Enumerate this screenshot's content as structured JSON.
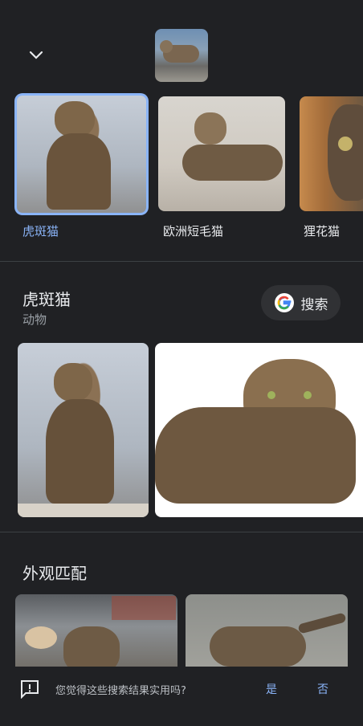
{
  "header": {
    "collapse_icon": "chevron-down-icon",
    "query_thumb_label": "query-image"
  },
  "chips": [
    {
      "label": "虎斑猫",
      "selected": true
    },
    {
      "label": "欧洲短毛猫",
      "selected": false
    },
    {
      "label": "狸花猫",
      "selected": false
    }
  ],
  "entity": {
    "title": "虎斑猫",
    "subtitle": "动物",
    "search_label": "搜索"
  },
  "visual_matches": {
    "title": "外观匹配"
  },
  "feedback": {
    "question": "您觉得这些搜索结果实用吗?",
    "yes": "是",
    "no": "否"
  },
  "colors": {
    "accent": "#8ab4f8",
    "background": "#202124"
  }
}
